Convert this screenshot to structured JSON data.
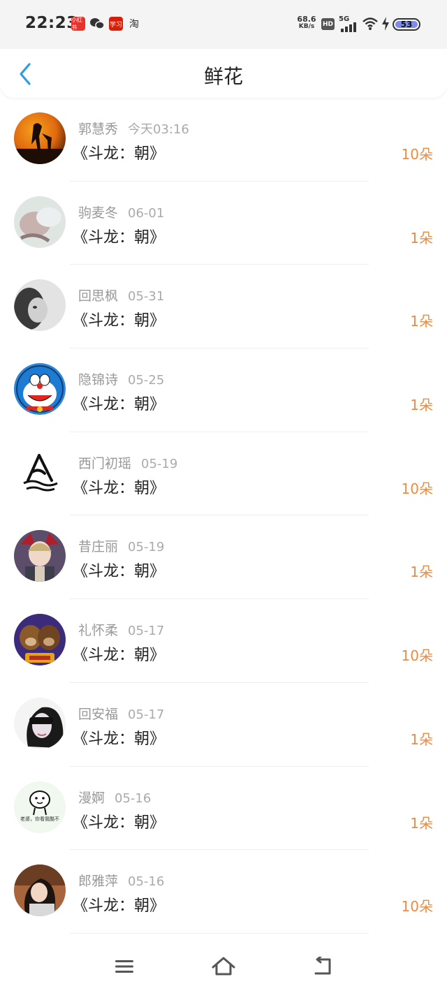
{
  "status_bar": {
    "time": "22:23",
    "net_speed_value": "68.6",
    "net_speed_unit": "KB/s",
    "hd": "HD",
    "network": "5G",
    "battery": "53",
    "apps": [
      {
        "icon": "xiaohongshu-icon",
        "label": "小红书",
        "color": "#e8332d"
      },
      {
        "icon": "wechat-icon",
        "color": "#333333"
      },
      {
        "icon": "xuexi-icon",
        "label": "学习",
        "color": "#d81e06"
      },
      {
        "icon": "taobao-icon",
        "label": "淘",
        "color": "#333333"
      }
    ]
  },
  "header": {
    "title": "鲜花",
    "back_icon": "chevron-left-icon",
    "accent_color": "#2f9be8"
  },
  "list": {
    "items": [
      {
        "name": "郭慧秀",
        "date": "今天03:16",
        "book": "《斗龙：朝》",
        "count": "10朵"
      },
      {
        "name": "驹麦冬",
        "date": "06-01",
        "book": "《斗龙：朝》",
        "count": "1朵"
      },
      {
        "name": "回思枫",
        "date": "05-31",
        "book": "《斗龙：朝》",
        "count": "1朵"
      },
      {
        "name": "隐锦诗",
        "date": "05-25",
        "book": "《斗龙：朝》",
        "count": "1朵"
      },
      {
        "name": "西门初瑶",
        "date": "05-19",
        "book": "《斗龙：朝》",
        "count": "10朵"
      },
      {
        "name": "昔庄丽",
        "date": "05-19",
        "book": "《斗龙：朝》",
        "count": "1朵"
      },
      {
        "name": "礼怀柔",
        "date": "05-17",
        "book": "《斗龙：朝》",
        "count": "10朵"
      },
      {
        "name": "回安福",
        "date": "05-17",
        "book": "《斗龙：朝》",
        "count": "1朵"
      },
      {
        "name": "漫婀",
        "date": "05-16",
        "book": "《斗龙：朝》",
        "count": "1朵"
      },
      {
        "name": "郎雅萍",
        "date": "05-16",
        "book": "《斗龙：朝》",
        "count": "10朵"
      }
    ],
    "count_color": "#f08a3e"
  },
  "avatar_caption": "老婆，你看我酷不",
  "bottom_nav": {
    "icons": [
      "menu-icon",
      "home-icon",
      "back-icon"
    ]
  }
}
